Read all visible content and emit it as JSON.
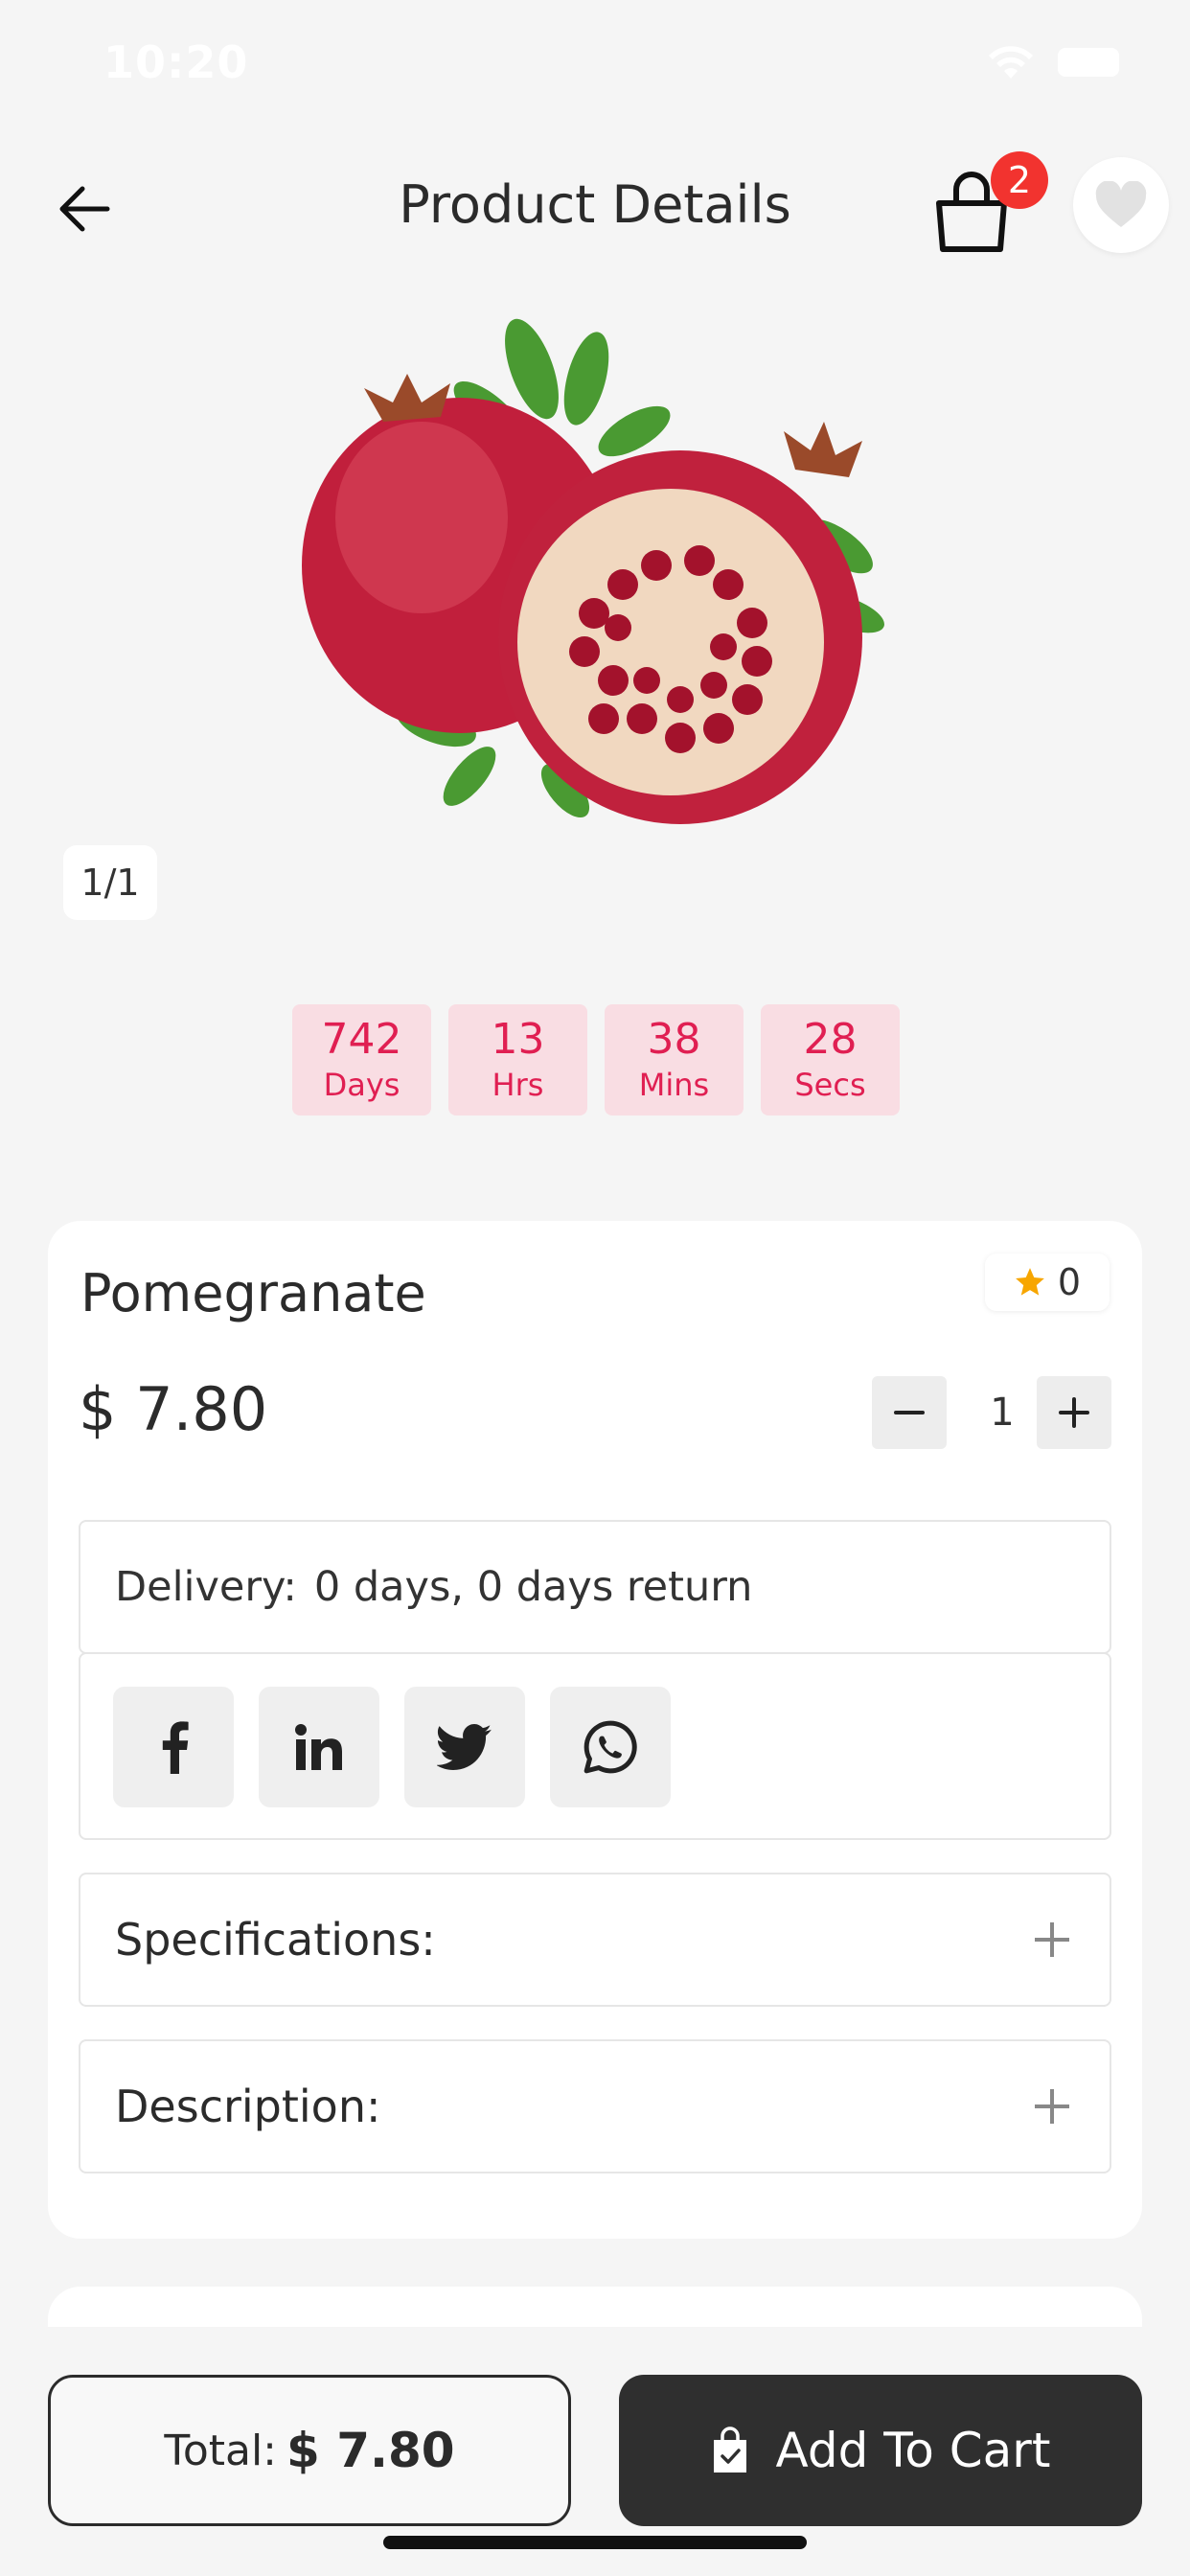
{
  "status_bar": {
    "time": "10:20"
  },
  "header": {
    "title": "Product Details",
    "cart_count": "2"
  },
  "gallery": {
    "counter": "1/1"
  },
  "countdown": [
    {
      "value": "742",
      "label": "Days"
    },
    {
      "value": "13",
      "label": "Hrs"
    },
    {
      "value": "38",
      "label": "Mins"
    },
    {
      "value": "28",
      "label": "Secs"
    }
  ],
  "product": {
    "name": "Pomegranate",
    "rating": "0",
    "price": "$ 7.80",
    "quantity": "1"
  },
  "delivery": {
    "label": "Delivery:",
    "value": "0 days, 0 days return"
  },
  "social": [
    "facebook-icon",
    "linkedin-icon",
    "twitter-icon",
    "whatsapp-icon"
  ],
  "sections": {
    "specifications": "Specifications:",
    "description": "Description:"
  },
  "footer": {
    "total_label": "Total:",
    "total_value": "$ 7.80",
    "add_to_cart": "Add To Cart"
  },
  "colors": {
    "accent": "#e01f52",
    "badge": "#f2332f",
    "countdown_bg": "#f9dde3",
    "dark_button": "#2f2f2f",
    "star": "#f7a600"
  }
}
